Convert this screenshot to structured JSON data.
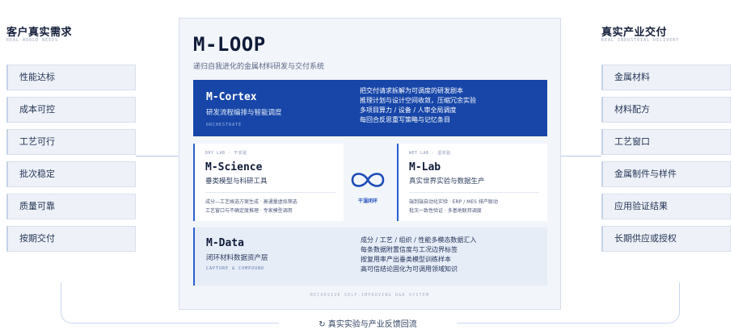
{
  "left": {
    "title": "客户真实需求",
    "subtitle": "REAL-WORLD NEEDS",
    "items": [
      "性能达标",
      "成本可控",
      "工艺可行",
      "批次稳定",
      "质量可靠",
      "按期交付"
    ]
  },
  "right": {
    "title": "真实产业交付",
    "subtitle": "REAL INDUSTRIAL DELIVERY",
    "items": [
      "金属材料",
      "材料配方",
      "工艺窗口",
      "金属制件与样件",
      "应用验证结果",
      "长期供应或授权"
    ]
  },
  "panel": {
    "title": "M-LOOP",
    "subtitle": "递归自我进化的金属材料研发与交付系统",
    "footer": "RECURSIVE SELF-IMPROVING R&D SYSTEM"
  },
  "cortex": {
    "name": "M-Cortex",
    "desc": "研发流程编排与智能调度",
    "tag": "ORCHESTRATE",
    "lines": [
      "把交付请求拆解为可调度的研发剧本",
      "推理计划与设计空间收敛，压缩冗余实验",
      "多项目算力 / 设备 / 人审全局调度",
      "每回合反思重写策略与记忆条目"
    ]
  },
  "science": {
    "tag": "DRY LAB · 干实验",
    "name": "M-Science",
    "desc": "垂类模型与科研工具",
    "line1": "成分—工艺候选方案生成 · 高通量虚拟筛选",
    "line2": "工艺窗口与不确定度推理 · 专家模型调用"
  },
  "lab": {
    "tag": "WET LAB · 湿实验",
    "name": "M-Lab",
    "desc": "真实世界实验与数据生产",
    "line1": "端到端自动化实验 · ERP / MES 排产联动",
    "line2": "批次一致性验证 · 多基地联邦调度"
  },
  "loop_center": {
    "label": "干湿闭环"
  },
  "data_layer": {
    "name": "M-Data",
    "desc": "闭环材料数据资产层",
    "tag": "CAPTURE & COMPOUND",
    "lines": [
      "成分 / 工艺 / 组织 / 性能多模态数据汇入",
      "每条数据附置信度与工况边界标签",
      "按复用率产出垂类模型训练样本",
      "高可信结论固化为可调用领域知识"
    ]
  },
  "feedback": {
    "label": "↻ 真实实验与产业反馈回流"
  },
  "colors": {
    "accent": "#1746a8",
    "panel_bg": "#f2f5fa",
    "side_bg": "#eef2f8"
  }
}
